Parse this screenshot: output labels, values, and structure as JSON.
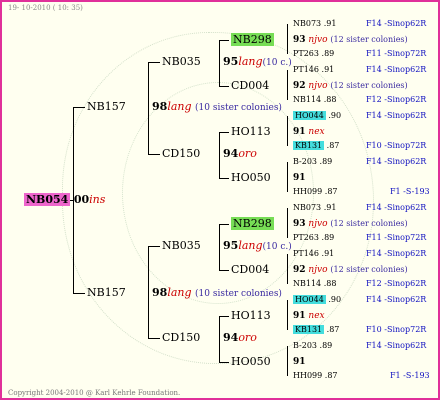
{
  "header": {
    "date": "19- 10-2010 ( 10: 35)"
  },
  "footer": {
    "copyright": "Copyright 2004-2010 @ Karl Kehrle Foundation."
  },
  "root": {
    "code": "NB054",
    "year": "00",
    "race": "ins"
  },
  "gen1": [
    {
      "code": "NB157",
      "year": "98",
      "race": "lang",
      "note": "(10 sister colonies)"
    },
    {
      "code": "NB157",
      "year": "98",
      "race": "lang",
      "note": "(10 sister colonies)"
    }
  ],
  "gen2": [
    {
      "code": "NB035",
      "year": "95",
      "race": "lang",
      "note": "(10 c.)"
    },
    {
      "code": "CD150",
      "year": "94",
      "race": "oro",
      "note": ""
    },
    {
      "code": "NB035",
      "year": "95",
      "race": "lang",
      "note": "(10 c.)"
    },
    {
      "code": "CD150",
      "year": "94",
      "race": "oro",
      "note": ""
    }
  ],
  "gen3": [
    {
      "code": "NB298",
      "year": "93",
      "race": "njvo",
      "note": "(12 sister colonies)"
    },
    {
      "code": "CD004",
      "year": "92",
      "race": "njvo",
      "note": "(12 sister colonies)"
    },
    {
      "code": "HO113",
      "year": "91",
      "race": "nex",
      "note": ""
    },
    {
      "code": "HO050",
      "year": "91",
      "race": "",
      "note": ""
    },
    {
      "code": "NB298",
      "year": "93",
      "race": "njvo",
      "note": "(12 sister colonies)"
    },
    {
      "code": "CD004",
      "year": "92",
      "race": "njvo",
      "note": "(12 sister colonies)"
    },
    {
      "code": "HO113",
      "year": "91",
      "race": "nex",
      "note": ""
    },
    {
      "code": "HO050",
      "year": "91",
      "race": "",
      "note": ""
    }
  ],
  "gen4": [
    {
      "code": "NB073",
      "year": ".91",
      "info": "F14 -Sinop62R"
    },
    {
      "code": "PT263",
      "year": ".89",
      "info": "F11 -Sinop72R"
    },
    {
      "code": "PT146",
      "year": ".91",
      "info": "F14 -Sinop62R"
    },
    {
      "code": "NB114",
      "year": ".88",
      "info": "F12 -Sinop62R"
    },
    {
      "code": "HO044",
      "year": ".90",
      "info": "F14 -Sinop62R"
    },
    {
      "code": "KB131",
      "year": ".87",
      "info": "F10 -Sinop72R"
    },
    {
      "code": "B-203",
      "year": ".89",
      "info": "F14 -Sinop62R"
    },
    {
      "code": "HH099",
      "year": ".87",
      "info": "F1 -S-193"
    },
    {
      "code": "NB073",
      "year": ".91",
      "info": "F14 -Sinop62R"
    },
    {
      "code": "PT263",
      "year": ".89",
      "info": "F11 -Sinop72R"
    },
    {
      "code": "PT146",
      "year": ".91",
      "info": "F14 -Sinop62R"
    },
    {
      "code": "NB114",
      "year": ".88",
      "info": "F12 -Sinop62R"
    },
    {
      "code": "HO044",
      "year": ".90",
      "info": "F14 -Sinop62R"
    },
    {
      "code": "KB131",
      "year": ".87",
      "info": "F10 -Sinop72R"
    },
    {
      "code": "B-203",
      "year": ".89",
      "info": "F14 -Sinop62R"
    },
    {
      "code": "HH099",
      "year": ".87",
      "info": "F1 -S-193"
    }
  ],
  "colors": {
    "border": "#e0309a",
    "root_box": "#ee66cc",
    "green_box": "#77dd55",
    "cyan_box": "#44dddd",
    "race": "#cc0000",
    "info": "#1010c0"
  }
}
